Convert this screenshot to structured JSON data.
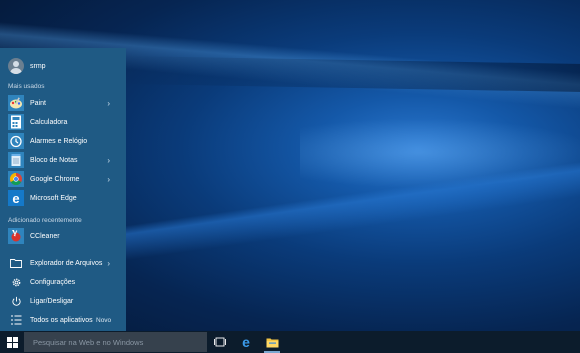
{
  "user": {
    "name": "srmp"
  },
  "most_used_label": "Mais usados",
  "apps": [
    {
      "label": "Paint",
      "icon": "paint-icon",
      "has_submenu": true
    },
    {
      "label": "Calculadora",
      "icon": "calculator-icon",
      "has_submenu": false
    },
    {
      "label": "Alarmes e Relógio",
      "icon": "alarm-clock-icon",
      "has_submenu": false
    },
    {
      "label": "Bloco de Notas",
      "icon": "notepad-icon",
      "has_submenu": true
    },
    {
      "label": "Google Chrome",
      "icon": "chrome-icon",
      "has_submenu": true
    },
    {
      "label": "Microsoft Edge",
      "icon": "edge-icon",
      "has_submenu": false
    }
  ],
  "recent_label": "Adicionado recentemente",
  "recent_apps": [
    {
      "label": "CCleaner",
      "icon": "ccleaner-icon"
    }
  ],
  "system": [
    {
      "label": "Explorador de Arquivos",
      "icon": "folder-icon",
      "has_submenu": true
    },
    {
      "label": "Configurações",
      "icon": "gear-icon",
      "has_submenu": false
    },
    {
      "label": "Ligar/Desligar",
      "icon": "power-icon",
      "has_submenu": false
    },
    {
      "label": "Todos os aplicativos",
      "icon": "all-apps-icon",
      "badge": "Novo"
    }
  ],
  "taskbar": {
    "search_placeholder": "Pesquisar na Web e no Windows"
  },
  "colors": {
    "start_menu_bg": "#1f5a84",
    "taskbar_bg": "#0c1c2c",
    "search_bg": "#36414d",
    "accent": "#0078d7"
  }
}
